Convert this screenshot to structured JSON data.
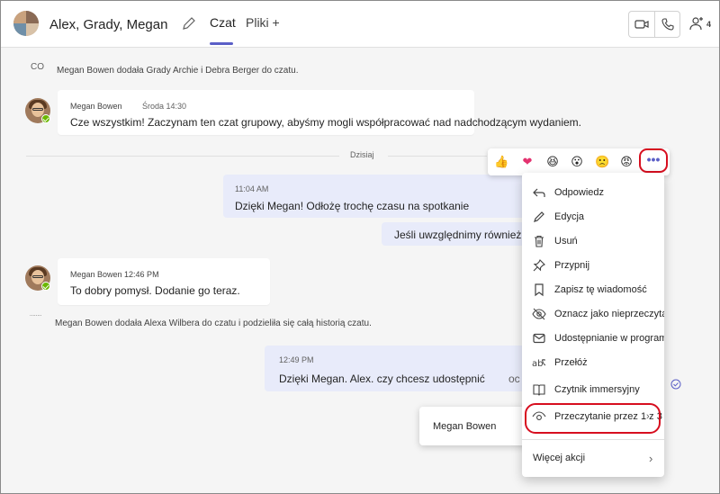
{
  "header": {
    "title": "Alex, Grady, Megan",
    "tabs": [
      {
        "label": "Czat"
      },
      {
        "label": "Pliki +"
      }
    ],
    "participants_count": "4"
  },
  "system_messages": [
    {
      "icon_text": "CO",
      "text": "Megan Bowen dodała Grady Archie i Debra Berger do czatu."
    },
    {
      "icon_text": "........",
      "text": "Megan Bowen dodała Alexa Wilbera do czatu i podzieliła się całą historią czatu."
    }
  ],
  "messages": {
    "m1": {
      "sender": "Megan Bowen",
      "time": "Środa 14:30",
      "text": "Cze wszystkim! Zaczynam ten czat grupowy, abyśmy mogli współpracować nad nadchodzącym wydaniem."
    },
    "day_divider": "Dzisiaj",
    "m2": {
      "time": "11:04 AM",
      "text": "Dzięki Megan! Odłożę trochę czasu na spotkanie"
    },
    "m3": {
      "text": "Jeśli uwzględnimy również A"
    },
    "m4": {
      "sender_time": "Megan Bowen 12:46 PM",
      "text": "To dobry pomysł. Dodanie go teraz."
    },
    "m5": {
      "time": "12:49 PM",
      "text": "Dzięki Megan. Alex. czy chcesz udostępnić",
      "trail": "oc"
    }
  },
  "reactions": [
    {
      "name": "like",
      "glyph": "👍"
    },
    {
      "name": "heart",
      "glyph": "❤"
    },
    {
      "name": "laugh",
      "glyph": "😆"
    },
    {
      "name": "surprised",
      "glyph": "😮"
    },
    {
      "name": "sad",
      "glyph": "🙁"
    },
    {
      "name": "angry",
      "glyph": "😡"
    }
  ],
  "more_label": "•••",
  "menu": {
    "items": [
      {
        "label": "Odpowiedz",
        "icon": "reply-icon"
      },
      {
        "label": "Edycja",
        "icon": "edit-icon"
      },
      {
        "label": "Usuń",
        "icon": "delete-icon"
      },
      {
        "label": "Przypnij",
        "icon": "pin-icon"
      },
      {
        "label": "Zapisz tę wiadomość",
        "icon": "bookmark-icon"
      },
      {
        "label": "Oznacz jako nieprzeczytane",
        "icon": "unread-icon"
      },
      {
        "label": "Udostępnianie w programie Outlook",
        "icon": "mail-icon"
      },
      {
        "label": "Przełóż",
        "icon": "translate-icon"
      },
      {
        "label": "Czytnik immersyjny",
        "icon": "immersive-reader-icon"
      },
      {
        "label": "Przeczytanie przez 1 z 3",
        "icon": "eye-icon"
      }
    ],
    "more_actions": "Więcej akcji"
  },
  "reader_card": {
    "name": "Megan Bowen"
  },
  "colors": {
    "accent": "#5b5fc7",
    "highlight_ring": "#d70e1f",
    "own_bubble": "#e8ebfa",
    "presence": "#6bb700"
  }
}
